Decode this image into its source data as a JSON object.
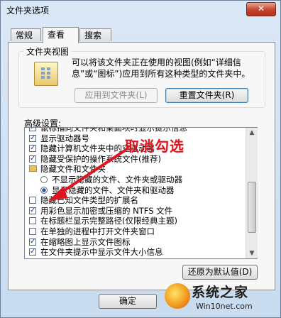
{
  "window": {
    "title": "文件夹选项",
    "close_glyph": "✕"
  },
  "tabs": [
    {
      "label": "常规",
      "active": false
    },
    {
      "label": "查看",
      "active": true
    },
    {
      "label": "搜索",
      "active": false
    }
  ],
  "folder_views": {
    "title": "文件夹视图",
    "description_line1": "可以将该文件夹正在使用的视图(例如“详细信",
    "description_line2": "息”或“图标”)应用到所有这种类型的文件夹中。",
    "apply_button": "应用到文件夹(L)",
    "reset_button": "重置文件夹(R)"
  },
  "advanced": {
    "label": "高级设置:",
    "items": [
      {
        "type": "checkbox",
        "checked": true,
        "indent": 0,
        "label": "鼠标指向文件夹和桌面项时显示提示信息"
      },
      {
        "type": "checkbox",
        "checked": true,
        "indent": 0,
        "label": "显示驱动器号"
      },
      {
        "type": "checkbox",
        "checked": true,
        "indent": 0,
        "label": "隐藏计算机文件夹中的空驱动器"
      },
      {
        "type": "checkbox",
        "checked": true,
        "indent": 0,
        "label": "隐藏受保护的操作系统文件(推荐)"
      },
      {
        "type": "folder",
        "indent": 0,
        "label": "隐藏文件和文件夹"
      },
      {
        "type": "radio",
        "checked": false,
        "indent": 1,
        "label": "不显示隐藏的文件、文件夹或驱动器"
      },
      {
        "type": "radio",
        "checked": true,
        "indent": 1,
        "label": "显示隐藏的文件、文件夹和驱动器"
      },
      {
        "type": "checkbox",
        "checked": false,
        "indent": 0,
        "label": "隐藏已知文件类型的扩展名"
      },
      {
        "type": "checkbox",
        "checked": true,
        "indent": 0,
        "label": "用彩色显示加密或压缩的 NTFS 文件"
      },
      {
        "type": "checkbox",
        "checked": false,
        "indent": 0,
        "label": "在标题栏显示完整路径(仅限经典主题)"
      },
      {
        "type": "checkbox",
        "checked": false,
        "indent": 0,
        "label": "在单独的进程中打开文件夹窗口"
      },
      {
        "type": "checkbox",
        "checked": true,
        "indent": 0,
        "label": "在缩略图上显示文件图标"
      },
      {
        "type": "checkbox",
        "checked": true,
        "indent": 0,
        "label": "在文件夹提示中显示文件大小信息"
      }
    ],
    "restore_button": "还原为默认值(D)"
  },
  "footer": {
    "ok_button": "确定"
  },
  "annotation": {
    "text": "取消勾选",
    "color": "#e0141e"
  },
  "watermark": {
    "main": "系统之家",
    "sub": "Win10net.com"
  }
}
